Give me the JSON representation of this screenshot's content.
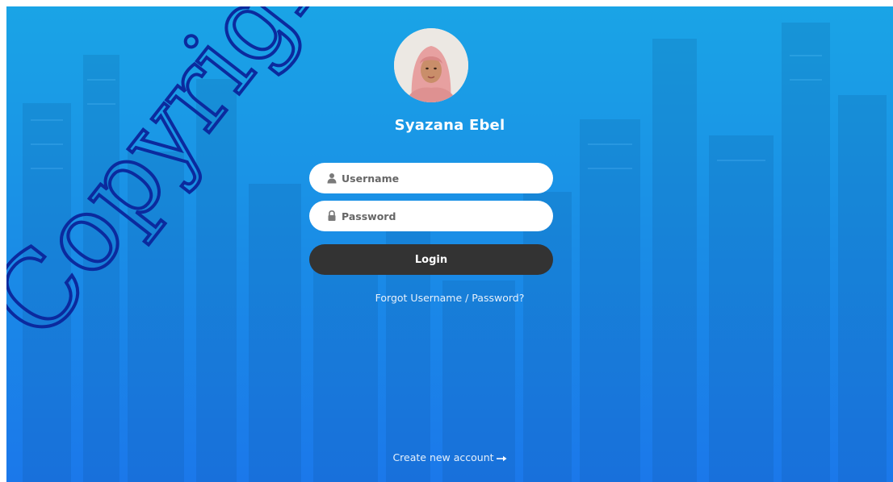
{
  "profile": {
    "name": "Syazana Ebel"
  },
  "login_form": {
    "username_placeholder": "Username",
    "password_placeholder": "Password",
    "login_label": "Login",
    "forgot_label": "Forgot Username / Password?"
  },
  "footer": {
    "create_account_label": "Create new account"
  },
  "icons": {
    "username": "user-icon",
    "password": "lock-icon",
    "create_account": "arrow-right-icon"
  },
  "watermark": {
    "text": "Copyright"
  },
  "colors": {
    "background_top": "#1aa4e6",
    "background_bottom": "#1b78ea",
    "button": "#333333",
    "watermark": "#0b2a9e"
  }
}
